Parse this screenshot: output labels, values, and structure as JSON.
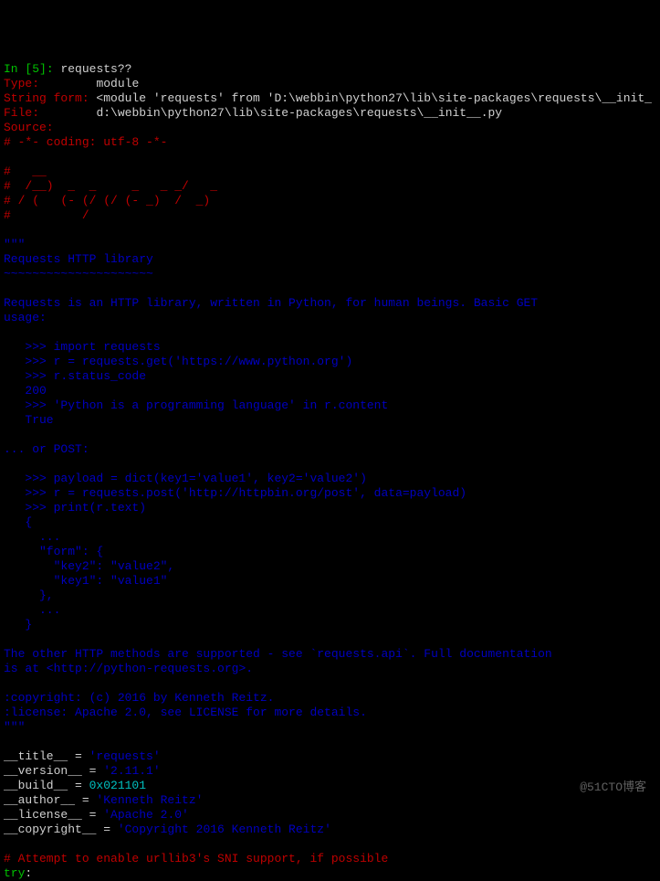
{
  "prompt": {
    "prefix": "In [",
    "number": "5",
    "suffix": "]: ",
    "command": "requests??"
  },
  "header": {
    "type_label": "Type:",
    "type_value": "module",
    "stringform_label": "String form:",
    "stringform_value": " <module 'requests' from 'D:\\webbin\\python27\\lib\\site-packages\\requests\\__init_",
    "file_label": "File:",
    "file_value": "d:\\webbin\\python27\\lib\\site-packages\\requests\\__init__.py",
    "source_label": "Source:"
  },
  "source": {
    "coding": "# -*- coding: utf-8 -*-",
    "ascii_art": [
      "#   __",
      "#  /__)  _  _     _   _ _/   _",
      "# / (   (- (/ (/ (- _)  /  _)",
      "#          /"
    ],
    "docstring_open": "\"\"\"",
    "title": "Requests HTTP library",
    "underline": "~~~~~~~~~~~~~~~~~~~~~",
    "desc1": "Requests is an HTTP library, written in Python, for human beings. Basic GET",
    "desc2": "usage:",
    "ex1_1": "   >>> import requests",
    "ex1_2": "   >>> r = requests.get('https://www.python.org')",
    "ex1_3": "   >>> r.status_code",
    "ex1_4": "   200",
    "ex1_5": "   >>> 'Python is a programming language' in r.content",
    "ex1_6": "   True",
    "post_label": "... or POST:",
    "ex2_1": "   >>> payload = dict(key1='value1', key2='value2')",
    "ex2_2": "   >>> r = requests.post('http://httpbin.org/post', data=payload)",
    "ex2_3": "   >>> print(r.text)",
    "ex2_4": "   {",
    "ex2_5": "     ...",
    "ex2_6": "     \"form\": {",
    "ex2_7": "       \"key2\": \"value2\",",
    "ex2_8": "       \"key1\": \"value1\"",
    "ex2_9": "     },",
    "ex2_10": "     ...",
    "ex2_11": "   }",
    "foot1": "The other HTTP methods are supported - see `requests.api`. Full documentation",
    "foot2": "is at <http://python-requests.org>.",
    "copyright": ":copyright: (c) 2016 by Kenneth Reitz.",
    "license": ":license: Apache 2.0, see LICENSE for more details.",
    "docstring_close": "\"\"\"",
    "assign": {
      "title_var": "__title__",
      "title_eq": " = ",
      "title_val": "'requests'",
      "version_var": "__version__",
      "version_eq": " = ",
      "version_val": "'2.11.1'",
      "build_var": "__build__",
      "build_eq": " = ",
      "build_val": "0x021101",
      "author_var": "__author__",
      "author_eq": " = ",
      "author_val": "'Kenneth Reitz'",
      "license_var": "__license__",
      "license_eq": " = ",
      "license_val": "'Apache 2.0'",
      "copyright_var": "__copyright__",
      "copyright_eq": " = ",
      "copyright_val": "'Copyright 2016 Kenneth Reitz'"
    },
    "comment_sni": "# Attempt to enable urllib3's SNI support, if possible",
    "try_line": "try",
    "try_colon": ":"
  },
  "watermark": "@51CTO博客"
}
